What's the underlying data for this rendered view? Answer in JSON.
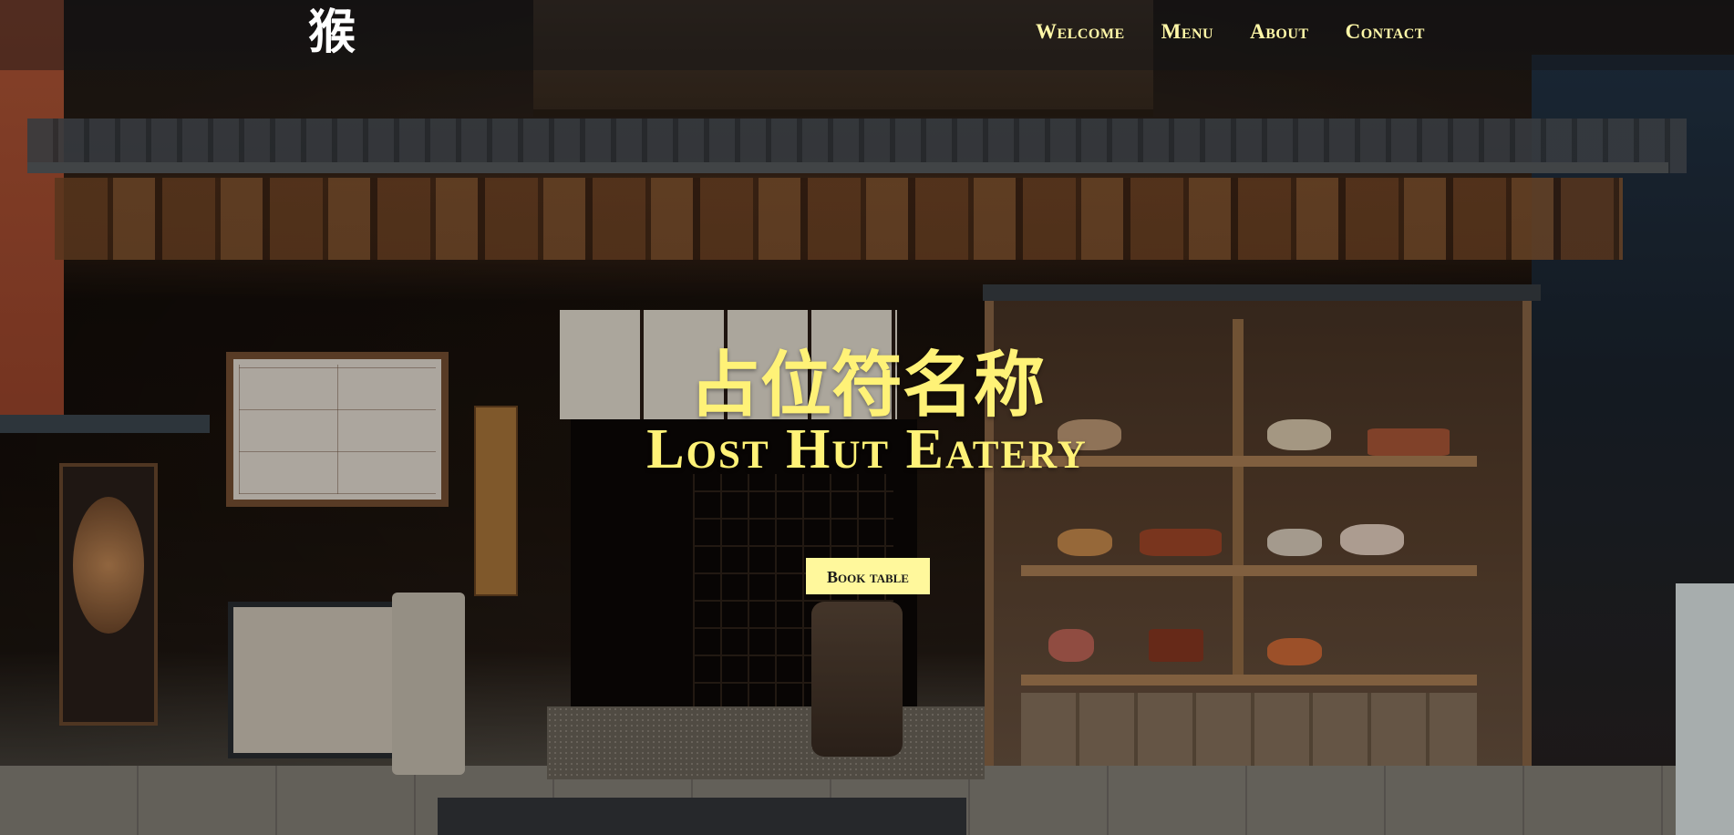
{
  "navbar": {
    "logo_text": "猴",
    "links": [
      {
        "label": "Welcome"
      },
      {
        "label": "Menu"
      },
      {
        "label": "About"
      },
      {
        "label": "Contact"
      }
    ]
  },
  "hero": {
    "title_chinese": "占位符名称",
    "title_english": "Lost Hut Eatery",
    "cta_label": "Book table",
    "background_image": "photo of traditional Japanese restaurant storefront with food display case"
  },
  "colors": {
    "accent": "#fff277",
    "button_bg": "#fff89c",
    "nav_overlay": "#141416"
  }
}
